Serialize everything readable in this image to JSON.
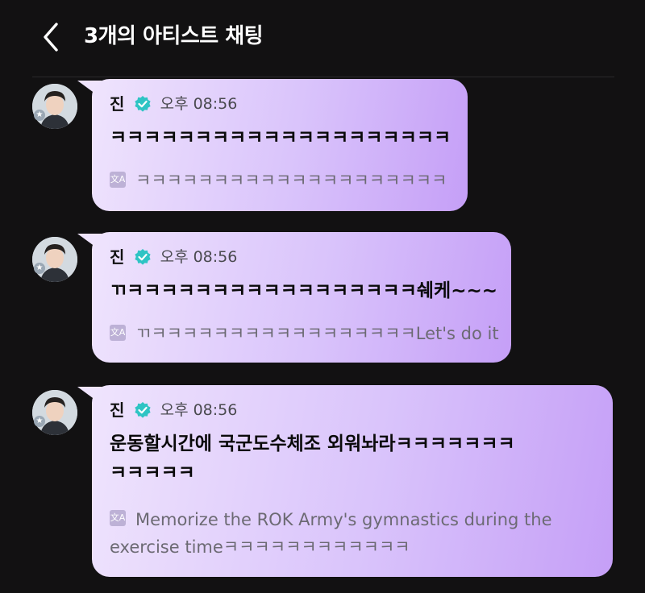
{
  "header": {
    "title": "3개의 아티스트 채팅",
    "back_icon": "chevron-left-icon"
  },
  "colors": {
    "background": "#121112",
    "bubble_start": "#efe4fd",
    "bubble_end": "#c59ff7",
    "verified": "#2ec4c4"
  },
  "messages": [
    {
      "sender": "진",
      "time": "오후 08:56",
      "text": "ㅋㅋㅋㅋㅋㅋㅋㅋㅋㅋㅋㅋㅋㅋㅋㅋㅋㅋㅋㅋ",
      "translation": "ㅋㅋㅋㅋㅋㅋㅋㅋㅋㅋㅋㅋㅋㅋㅋㅋㅋㅋㅋㅋ"
    },
    {
      "sender": "진",
      "time": "오후 08:56",
      "text": "ㄲㅋㅋㅋㅋㅋㅋㅋㅋㅋㅋㅋㅋㅋㅋㅋㅋㅋ쉐케~~~",
      "translation": "ㄲㅋㅋㅋㅋㅋㅋㅋㅋㅋㅋㅋㅋㅋㅋㅋㅋㅋLet's do it"
    },
    {
      "sender": "진",
      "time": "오후 08:56",
      "text_line1": "운동할시간에 국군도수체조 외워놔라ㅋㅋㅋㅋㅋㅋㅋ",
      "text_line2": "ㅋㅋㅋㅋㅋ",
      "translation_line1": "Memorize the ROK Army's gymnastics during the",
      "translation_line2": "exercise timeㅋㅋㅋㅋㅋㅋㅋㅋㅋㅋㅋㅋ"
    }
  ]
}
